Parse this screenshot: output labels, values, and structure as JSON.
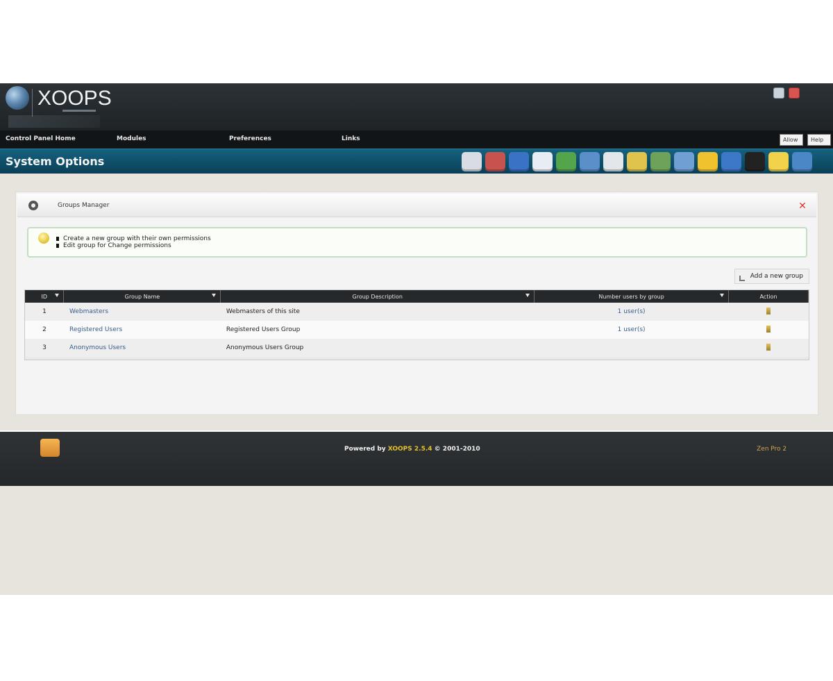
{
  "header": {
    "logo_text": "XOOPS"
  },
  "menu": {
    "control_panel": "Control Panel Home",
    "modules": "Modules",
    "preferences": "Preferences",
    "links": "Links",
    "btn_user": "Allow",
    "btn_help": "Help"
  },
  "titlebar": {
    "title": "System Options",
    "icon_colors": [
      "#d9dde3",
      "#c7534f",
      "#3a73c6",
      "#e8edf3",
      "#55a34a",
      "#5b8fc9",
      "#e4e7ea",
      "#e0c34c",
      "#6ea25b",
      "#6f9fd3",
      "#f0c22e",
      "#3d78c8",
      "#222222",
      "#f2d14b",
      "#4b86c6"
    ]
  },
  "panel": {
    "title": "Groups Manager",
    "tips": [
      "Create a new group with their own permissions",
      "Edit group for Change permissions"
    ],
    "add_button": "Add a new group"
  },
  "grid": {
    "headers": {
      "id": "ID",
      "name": "Group Name",
      "description": "Group Description",
      "count": "Number users by group",
      "action": "Action"
    },
    "rows": [
      {
        "id": "1",
        "name": "Webmasters",
        "description": "Webmasters of this site",
        "count": "1 user(s)"
      },
      {
        "id": "2",
        "name": "Registered Users",
        "description": "Registered Users Group",
        "count": "1 user(s)"
      },
      {
        "id": "3",
        "name": "Anonymous Users",
        "description": "Anonymous Users Group",
        "count": ""
      }
    ]
  },
  "footer": {
    "powered_by": "Powered by",
    "brand": "XOOPS 2.5.4",
    "copyright": "© 2001-2010",
    "right_link": "Zen Pro 2"
  }
}
